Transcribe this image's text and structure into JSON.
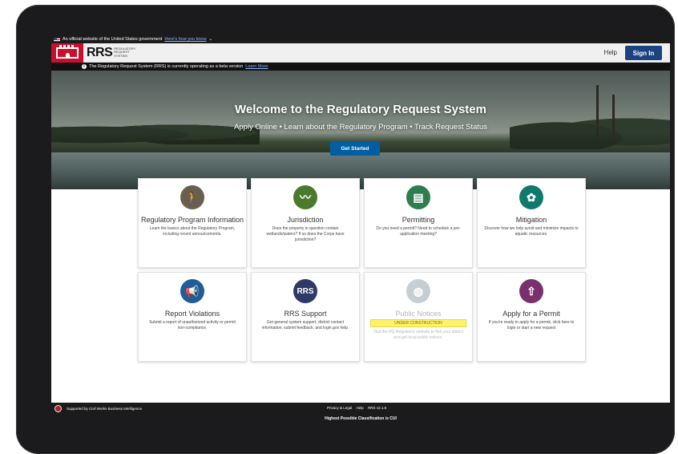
{
  "gov_banner": {
    "text": "An official website of the United States government",
    "link": "Here's how you know"
  },
  "header": {
    "logo_mark": "RRS",
    "logo_subtitle": "Regulatory Request System",
    "help": "Help",
    "sign_in": "Sign In"
  },
  "alert": {
    "text": "The Regulatory Request System (RRS) is currently operating as a beta version",
    "link": "Learn More"
  },
  "hero": {
    "title": "Welcome to the Regulatory Request System",
    "subtitle": "Apply Online • Learn about the Regulatory Program • Track Request Status",
    "cta": "Get Started"
  },
  "cards": [
    {
      "title": "Regulatory Program Information",
      "desc": "Learn the basics about the Regulatory Program, including recent announcements.",
      "icon": "person-icon",
      "color": "#6b5e4c"
    },
    {
      "title": "Jurisdiction",
      "desc": "Does the property in question contain wetlands/waters? If so does the Corps have jurisdiction?",
      "icon": "river-icon",
      "color": "#4a7a2c"
    },
    {
      "title": "Permitting",
      "desc": "Do you need a permit? Need to schedule a pre-application meeting?",
      "icon": "document-icon",
      "color": "#2e7d4f"
    },
    {
      "title": "Mitigation",
      "desc": "Discover how we help avoid and minimize impacts to aquatic resources.",
      "icon": "plant-icon",
      "color": "#0f7a6c"
    },
    {
      "title": "Report Violations",
      "desc": "Submit a report of unauthorized activity or permit non-compliance.",
      "icon": "megaphone-icon",
      "color": "#1f5c99"
    },
    {
      "title": "RRS Support",
      "desc": "Get general system support, district contact information, submit feedback, and login.gov help.",
      "icon": "rrs-icon",
      "color": "#2d3a66"
    },
    {
      "title": "Public Notices",
      "badge": "UNDER CONSTRUCTION",
      "desc": "Visit the HQ Regulatory website to find your district and get local public notices.",
      "icon": "globe-icon",
      "color": "#c7ced3",
      "disabled": true
    },
    {
      "title": "Apply for a Permit",
      "desc": "If you're ready to apply for a permit, click here to login or start a new request",
      "icon": "upload-icon",
      "color": "#7a2f6e"
    }
  ],
  "footer": {
    "supported": "Supported by Civil Works Business Intelligence",
    "links": [
      "Privacy & Legal",
      "Help",
      "RRS v2.1.6"
    ],
    "classification": "Highest Possible Classification is CUI"
  }
}
